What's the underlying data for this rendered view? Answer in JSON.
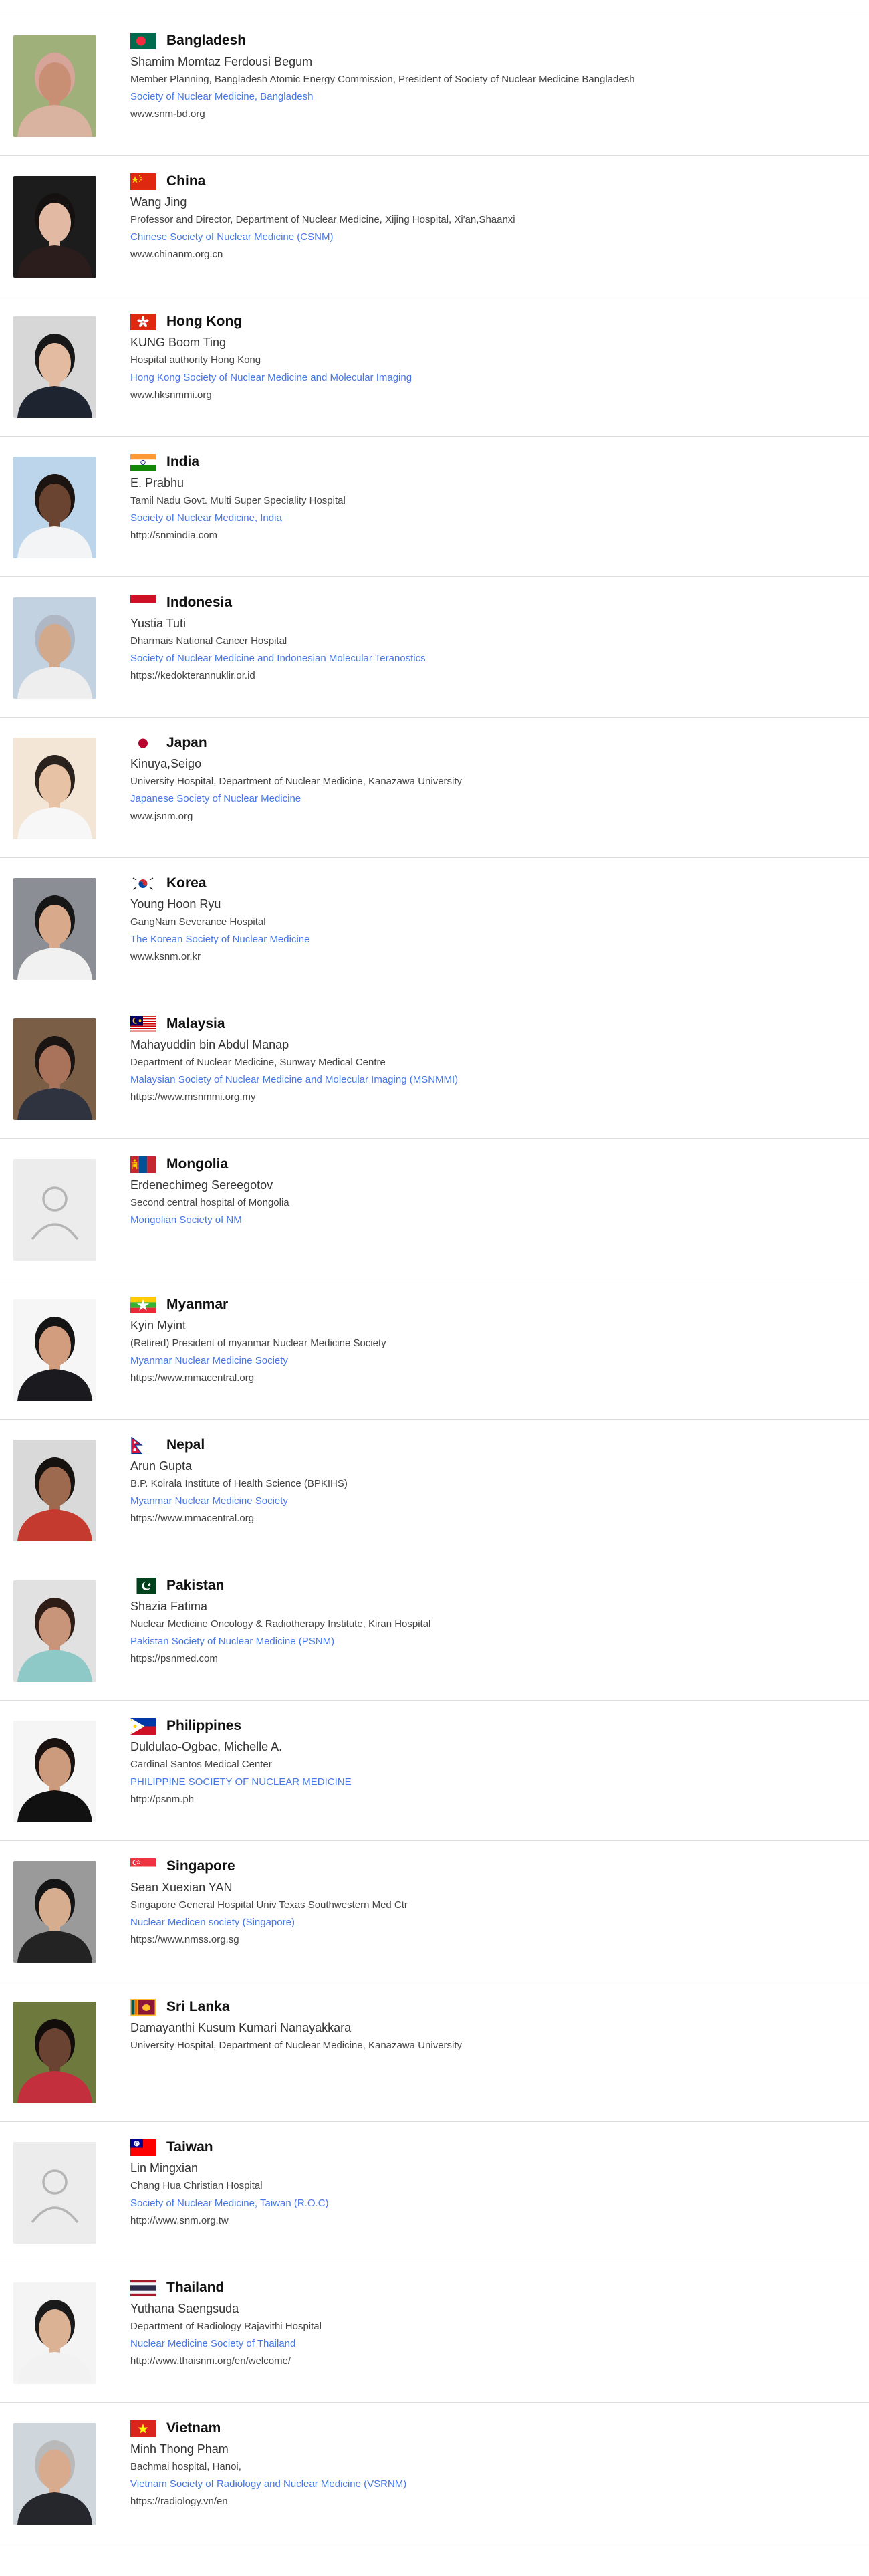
{
  "members": [
    {
      "country": "Bangladesh",
      "name": "Shamim Momtaz Ferdousi Begum",
      "position": "Member Planning, Bangladesh Atomic Energy Commission, President of Society of Nuclear Medicine Bangladesh",
      "society": "Society of Nuclear Medicine, Bangladesh",
      "website": "www.snm-bd.org",
      "flag": "bangladesh-flag-icon",
      "photo": "photo",
      "photo_colors": {
        "bg": "#9fb07a",
        "skin": "#c98f74",
        "wear": "#d9b2a0",
        "hair": "#d7a49a"
      }
    },
    {
      "country": "China",
      "name": "Wang Jing",
      "position": "Professor and Director, Department of Nuclear Medicine, Xijing Hospital, Xi'an,Shaanxi",
      "society": "Chinese Society of Nuclear Medicine (CSNM)",
      "website": "www.chinanm.org.cn",
      "flag": "china-flag-icon",
      "photo": "photo",
      "photo_colors": {
        "bg": "#1c1c1c",
        "skin": "#e2b9a3",
        "wear": "#2b1d1c",
        "hair": "#151111"
      }
    },
    {
      "country": "Hong Kong",
      "name": "KUNG Boom Ting",
      "position": "Hospital authority Hong Kong",
      "society": "Hong Kong Society of Nuclear Medicine and Molecular Imaging",
      "website": "www.hksnmmi.org",
      "flag": "hong-kong-flag-icon",
      "photo": "photo",
      "photo_colors": {
        "bg": "#d7d7d7",
        "skin": "#e3bba0",
        "wear": "#1e2430",
        "hair": "#171717"
      }
    },
    {
      "country": "India",
      "name": "E. Prabhu",
      "position": "Tamil Nadu Govt. Multi Super Speciality Hospital",
      "society": "Society of Nuclear Medicine, India",
      "website": "http://snmindia.com",
      "flag": "india-flag-icon",
      "photo": "photo",
      "photo_colors": {
        "bg": "#bcd5ea",
        "skin": "#6b4431",
        "wear": "#f2f4f6",
        "hair": "#1b1410"
      }
    },
    {
      "country": "Indonesia",
      "name": "Yustia Tuti",
      "position": "Dharmais National Cancer Hospital",
      "society": "Society of Nuclear Medicine and Indonesian Molecular Teranostics",
      "website": "https://kedokterannuklir.or.id",
      "flag": "indonesia-flag-icon",
      "photo": "photo",
      "photo_colors": {
        "bg": "#c3d2e0",
        "skin": "#d3a98c",
        "wear": "#eeeeee",
        "hair": "#aeb7c3"
      }
    },
    {
      "country": "Japan",
      "name": "Kinuya,Seigo",
      "position": "University Hospital, Department of Nuclear Medicine, Kanazawa University",
      "society": "Japanese Society of Nuclear Medicine",
      "website": "www.jsnm.org",
      "flag": "japan-flag-icon",
      "photo": "photo",
      "photo_colors": {
        "bg": "#f3e6d6",
        "skin": "#e7c2a4",
        "wear": "#f7f7f7",
        "hair": "#2a221c"
      }
    },
    {
      "country": "Korea",
      "name": "Young Hoon Ryu",
      "position": "GangNam Severance Hospital",
      "society": "The Korean Society of Nuclear Medicine",
      "website": "www.ksnm.or.kr",
      "flag": "korea-flag-icon",
      "photo": "photo",
      "photo_colors": {
        "bg": "#8b8f95",
        "skin": "#d8a98a",
        "wear": "#f1f1f1",
        "hair": "#161616"
      }
    },
    {
      "country": "Malaysia",
      "name": "Mahayuddin bin Abdul Manap",
      "position": "Department of Nuclear Medicine, Sunway Medical Centre",
      "society": "Malaysian Society of Nuclear Medicine and Molecular Imaging (MSNMMI)",
      "website": "https://www.msnmmi.org.my",
      "flag": "malaysia-flag-icon",
      "photo": "photo",
      "photo_colors": {
        "bg": "#7b5e46",
        "skin": "#a8735a",
        "wear": "#2f3340",
        "hair": "#1a1412"
      }
    },
    {
      "country": "Mongolia",
      "name": "Erdenechimeg Sereegotov",
      "position": "Second central hospital of Mongolia",
      "society": "Mongolian Society of NM",
      "website": "",
      "flag": "mongolia-flag-icon",
      "photo": "placeholder",
      "photo_colors": {
        "bg": "#ececec",
        "skin": "#bdbdbd",
        "wear": "#bdbdbd",
        "hair": "#bdbdbd"
      }
    },
    {
      "country": "Myanmar",
      "name": "Kyin Myint",
      "position": "(Retired) President of myanmar Nuclear Medicine Society",
      "society": "Myanmar Nuclear Medicine Society",
      "website": "https://www.mmacentral.org",
      "flag": "myanmar-flag-icon",
      "photo": "photo",
      "photo_colors": {
        "bg": "#f6f6f6",
        "skin": "#d19d7e",
        "wear": "#1b1b1f",
        "hair": "#141414"
      }
    },
    {
      "country": "Nepal",
      "name": "Arun Gupta",
      "position": "B.P. Koirala Institute of Health Science (BPKIHS)",
      "society": "Myanmar Nuclear Medicine Society",
      "website": "https://www.mmacentral.org",
      "flag": "nepal-flag-icon",
      "photo": "photo",
      "photo_colors": {
        "bg": "#d9d9d9",
        "skin": "#9d6a4f",
        "wear": "#c43a2e",
        "hair": "#161210"
      }
    },
    {
      "country": "Pakistan",
      "name": "Shazia Fatima",
      "position": "Nuclear Medicine Oncology & Radiotherapy Institute, Kiran Hospital",
      "society": "Pakistan Society of Nuclear Medicine (PSNM)",
      "website": "https://psnmed.com",
      "flag": "pakistan-flag-icon",
      "photo": "photo",
      "photo_colors": {
        "bg": "#e1e1e1",
        "skin": "#c8947a",
        "wear": "#8fc9c7",
        "hair": "#2e1c16"
      }
    },
    {
      "country": "Philippines",
      "name": "Duldulao-Ogbac, Michelle A.",
      "position": "Cardinal Santos Medical Center",
      "society": "PHILIPPINE SOCIETY OF NUCLEAR MEDICINE",
      "website": "http://psnm.ph",
      "flag": "philippines-flag-icon",
      "photo": "photo",
      "photo_colors": {
        "bg": "#f5f5f5",
        "skin": "#cc9a7c",
        "wear": "#111111",
        "hair": "#1a1210"
      }
    },
    {
      "country": "Singapore",
      "name": "Sean Xuexian YAN",
      "position": "Singapore General Hospital Univ Texas Southwestern Med Ctr",
      "society": "Nuclear Medicen society (Singapore)",
      "website": "https://www.nmss.org.sg",
      "flag": "singapore-flag-icon",
      "photo": "photo",
      "photo_colors": {
        "bg": "#9a9a9a",
        "skin": "#d7ad90",
        "wear": "#232323",
        "hair": "#141414"
      }
    },
    {
      "country": "Sri Lanka",
      "name": "Damayanthi Kusum Kumari Nanayakkara",
      "position": "University Hospital, Department of Nuclear Medicine, Kanazawa University",
      "society": "",
      "website": "",
      "flag": "sri-lanka-flag-icon",
      "photo": "photo",
      "photo_colors": {
        "bg": "#6e7a3d",
        "skin": "#6b4333",
        "wear": "#c32f3c",
        "hair": "#120d0b"
      }
    },
    {
      "country": "Taiwan",
      "name": "Lin Mingxian",
      "position": "Chang Hua Christian Hospital",
      "society": "Society of Nuclear Medicine, Taiwan (R.O.C)",
      "website": "http://www.snm.org.tw",
      "flag": "taiwan-flag-icon",
      "photo": "placeholder",
      "photo_colors": {
        "bg": "#ececec",
        "skin": "#bdbdbd",
        "wear": "#bdbdbd",
        "hair": "#bdbdbd"
      }
    },
    {
      "country": "Thailand",
      "name": "Yuthana Saengsuda",
      "position": "Department of Radiology Rajavithi Hospital",
      "society": "Nuclear Medicine Society of Thailand",
      "website": "http://www.thaisnm.org/en/welcome/",
      "flag": "thailand-flag-icon",
      "photo": "photo",
      "photo_colors": {
        "bg": "#f4f4f4",
        "skin": "#dcb295",
        "wear": "#f2f2f2",
        "hair": "#1a1a1a"
      }
    },
    {
      "country": "Vietnam",
      "name": "Minh Thong Pham",
      "position": "Bachmai hospital, Hanoi,",
      "society": "Vietnam Society of Radiology and Nuclear Medicine (VSRNM)",
      "website": "https://radiology.vn/en",
      "flag": "vietnam-flag-icon",
      "photo": "photo",
      "photo_colors": {
        "bg": "#cfd6dc",
        "skin": "#d8ab8e",
        "wear": "#25272c",
        "hair": "#b9b9b9"
      }
    }
  ]
}
